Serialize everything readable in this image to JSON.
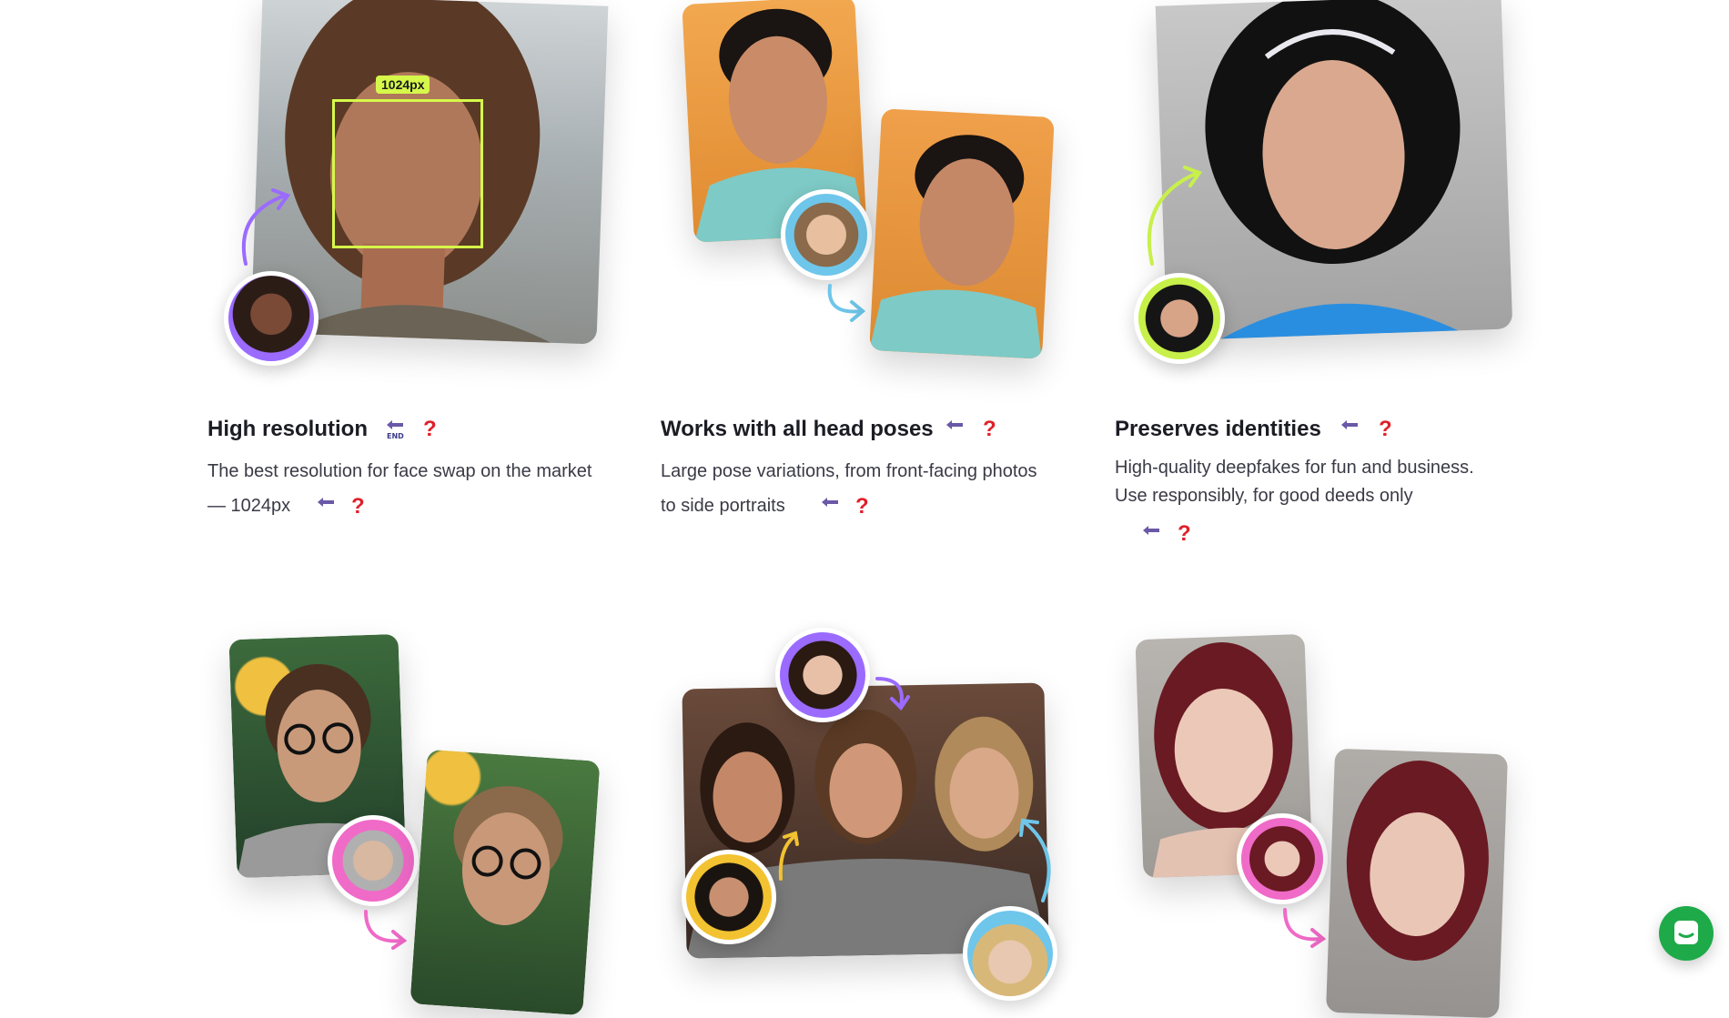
{
  "features": [
    {
      "title": "High resolution",
      "desc_line1": "The best resolution for face swap on the market",
      "desc_line2": "— 1024px",
      "tag": "1024px"
    },
    {
      "title": "Works with all head poses",
      "desc_line1": "Large pose variations, from front-facing photos",
      "desc_line2": "to side portraits"
    },
    {
      "title": "Preserves identities",
      "desc_line1": "High-quality deepfakes for fun and business.",
      "desc_line2": "Use responsibly, for good deeds only"
    }
  ],
  "icons": {
    "end_label": "END",
    "question": "?"
  },
  "colors": {
    "accent_lime": "#d6f84a",
    "purple": "#9b6bff",
    "cyan": "#6ec6ea",
    "pink": "#f06ac8",
    "yellow": "#f2c230",
    "chat_green": "#1faa4a"
  }
}
